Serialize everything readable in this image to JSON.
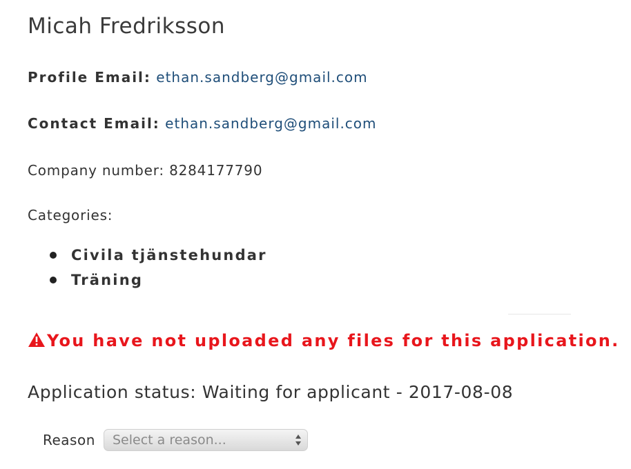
{
  "applicant": {
    "name": "Micah Fredriksson"
  },
  "profile_email": {
    "label": "Profile Email:",
    "value": "ethan.sandberg@gmail.com"
  },
  "contact_email": {
    "label": "Contact Email:",
    "value": "ethan.sandberg@gmail.com"
  },
  "company": {
    "text": "Company number: 8284177790"
  },
  "categories": {
    "label": "Categories:",
    "items": [
      "Civila tjänstehundar",
      "Träning"
    ]
  },
  "warning": {
    "icon": "warning-triangle-icon",
    "text": "You have not uploaded any files for this application.",
    "color": "#e8161c"
  },
  "status": {
    "text": "Application status: Waiting for applicant - 2017-08-08"
  },
  "reason": {
    "label": "Reason",
    "placeholder": "Select a reason..."
  },
  "colors": {
    "link": "#1f4e79",
    "text": "#333333"
  }
}
